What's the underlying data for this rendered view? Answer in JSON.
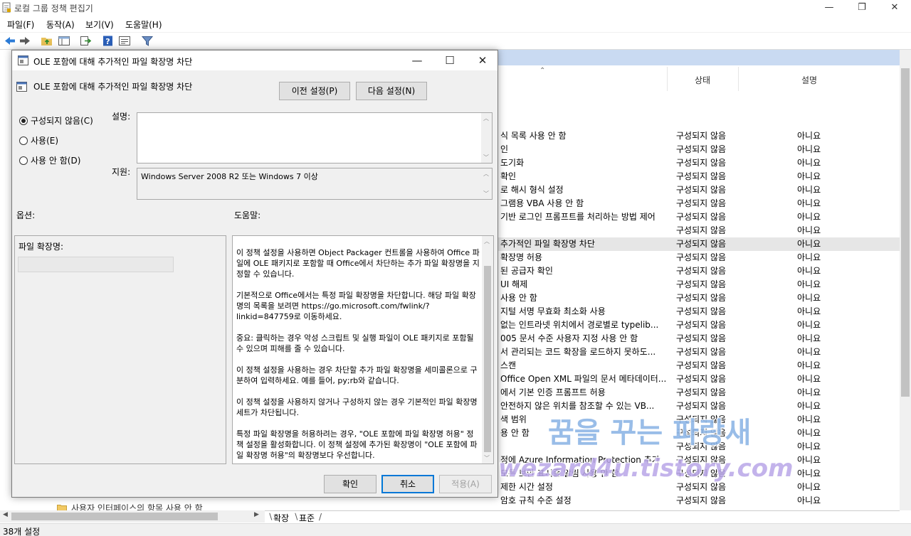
{
  "app": {
    "title": "로컬 그룹 정책 편집기"
  },
  "menu": [
    "파일(F)",
    "동작(A)",
    "보기(V)",
    "도움말(H)"
  ],
  "toolbar": {
    "icons": [
      "back-arrow-icon",
      "forward-arrow-icon",
      "folder-up-icon",
      "show-hide-tree-icon",
      "export-list-icon",
      "help-icon",
      "properties-icon",
      "filter-icon"
    ]
  },
  "list": {
    "columns": {
      "status": "상태",
      "description": "설명"
    },
    "rows": [
      {
        "name": "식 목록 사용 안 함",
        "status": "구성되지 않음",
        "desc": "아니요"
      },
      {
        "name": "인",
        "status": "구성되지 않음",
        "desc": "아니요"
      },
      {
        "name": "도기화",
        "status": "구성되지 않음",
        "desc": "아니요"
      },
      {
        "name": "확인",
        "status": "구성되지 않음",
        "desc": "아니요"
      },
      {
        "name": "로 해시 형식 설정",
        "status": "구성되지 않음",
        "desc": "아니요"
      },
      {
        "name": "그램용 VBA 사용 안 함",
        "status": "구성되지 않음",
        "desc": "아니요"
      },
      {
        "name": "기반 로그인 프롬프트를 처리하는 방법 제어",
        "status": "구성되지 않음",
        "desc": "아니요"
      },
      {
        "name": "",
        "status": "구성되지 않음",
        "desc": "아니요"
      },
      {
        "name": "추가적인 파일 확장명 차단",
        "status": "구성되지 않음",
        "desc": "아니요",
        "selected": true
      },
      {
        "name": "확장명 허용",
        "status": "구성되지 않음",
        "desc": "아니요"
      },
      {
        "name": "된 공급자 확인",
        "status": "구성되지 않음",
        "desc": "아니요"
      },
      {
        "name": "UI 해제",
        "status": "구성되지 않음",
        "desc": "아니요"
      },
      {
        "name": "사용 안 함",
        "status": "구성되지 않음",
        "desc": "아니요"
      },
      {
        "name": "지털 서명 무효화 최소화 사용",
        "status": "구성되지 않음",
        "desc": "아니요"
      },
      {
        "name": "없는 인트라넷 위치에서 경로별로 typelib...",
        "status": "구성되지 않음",
        "desc": "아니요"
      },
      {
        "name": "005 문서 수준 사용자 지정 사용 안 함",
        "status": "구성되지 않음",
        "desc": "아니요"
      },
      {
        "name": "서 관리되는 코드 확장을 로드하지 못하도...",
        "status": "구성되지 않음",
        "desc": "아니요"
      },
      {
        "name": "스캔",
        "status": "구성되지 않음",
        "desc": "아니요"
      },
      {
        "name": "Office Open XML 파일의 문서 메타데이터...",
        "status": "구성되지 않음",
        "desc": "아니요"
      },
      {
        "name": "에서 기본 인증 프롬프트 허용",
        "status": "구성되지 않음",
        "desc": "아니요"
      },
      {
        "name": "안전하지 않은 위치를 참조할 수 있는 VB...",
        "status": "구성되지 않음",
        "desc": "아니요"
      },
      {
        "name": "색 범위",
        "status": "구성되지 않음",
        "desc": "아니요"
      },
      {
        "name": "용 안 함",
        "status": "구성되지 않음",
        "desc": "아니요"
      },
      {
        "name": "",
        "status": "구성되지 않음",
        "desc": "아니요"
      },
      {
        "name": "정에 Azure Information Protection 추가",
        "status": "구성되지 않음",
        "desc": "아니요"
      },
      {
        "name": "모든 보안 표시줄 알림 사용 안 함",
        "status": "구성되지 않음",
        "desc": "아니요"
      },
      {
        "name": "제한 시간 설정",
        "status": "구성되지 않음",
        "desc": "아니요"
      },
      {
        "name": "암호 규칙 수준 설정",
        "status": "구성되지 않음",
        "desc": "아니요"
      }
    ]
  },
  "tree": {
    "visible_item": "사용자 인터페이스의 항목 사용 안 함"
  },
  "tabs": [
    "확장",
    "표준"
  ],
  "status_bar": {
    "text": "38개 설정"
  },
  "dialog": {
    "title": "OLE 포함에 대해 추가적인 파일 확장명 차단",
    "setting_name": "OLE 포함에 대해 추가적인 파일 확장명 차단",
    "prev_button": "이전 설정(P)",
    "next_button": "다음 설정(N)",
    "radios": [
      {
        "label": "구성되지 않음(C)",
        "checked": true
      },
      {
        "label": "사용(E)",
        "checked": false
      },
      {
        "label": "사용 안 함(D)",
        "checked": false
      }
    ],
    "comment_label": "설명:",
    "comment_value": "",
    "supported_label": "지원:",
    "supported_value": "Windows Server 2008 R2 또는 Windows 7 이상",
    "options_label": "옵션:",
    "help_label": "도움말:",
    "option_field_label": "파일 확장명:",
    "option_field_value": "",
    "help_paragraphs": [
      "이 정책 설정을 사용하면 Object Packager 컨트롤을 사용하여 Office 파일에 OLE 패키지로 포함할 때 Office에서 차단하는 추가 파일 확장명을 지정할 수 있습니다.",
      "기본적으로 Office에서는 특정 파일 확장명을 차단합니다. 해당 파일 확장명의 목록을 보려면 https://go.microsoft.com/fwlink/?linkid=847759로 이동하세요.",
      "중요: 클릭하는 경우 악성 스크립트 및 실행 파일이 OLE 패키지로 포함될 수 있으며 피해를 줄 수 있습니다.",
      "이 정책 설정을 사용하는 경우 차단할 추가 파일 확장명을 세미콜론으로 구분하여 입력하세요. 예를 들어, py;rb와 같습니다.",
      "이 정책 설정을 사용하지 않거나 구성하지 않는 경우 기본적인 파일 확장명 세트가 차단됩니다.",
      "특정 파일 확장명을 허용하려는 경우, \"OLE 포함에 파일 확장명 허용\" 정책 설정을 활성화합니다. 이 정책 설정에 추가된 확장명이 \"OLE 포함에 파일 확장명 허용\"의 확장명보다 우선합니다."
    ],
    "ok_button": "확인",
    "cancel_button": "취소",
    "apply_button": "적용(A)"
  },
  "watermark": {
    "line1": "꿈을 꾸는 파랑새",
    "line2": "wezard4u.tistory.com"
  },
  "colors": {
    "selection_strip": "#c9daf2",
    "dialog_bg": "#f0f0f0",
    "default_button_border": "#0078d7",
    "watermark_fill": "#8fb6e6",
    "watermark_line2_fill": "#b9a6e8"
  }
}
